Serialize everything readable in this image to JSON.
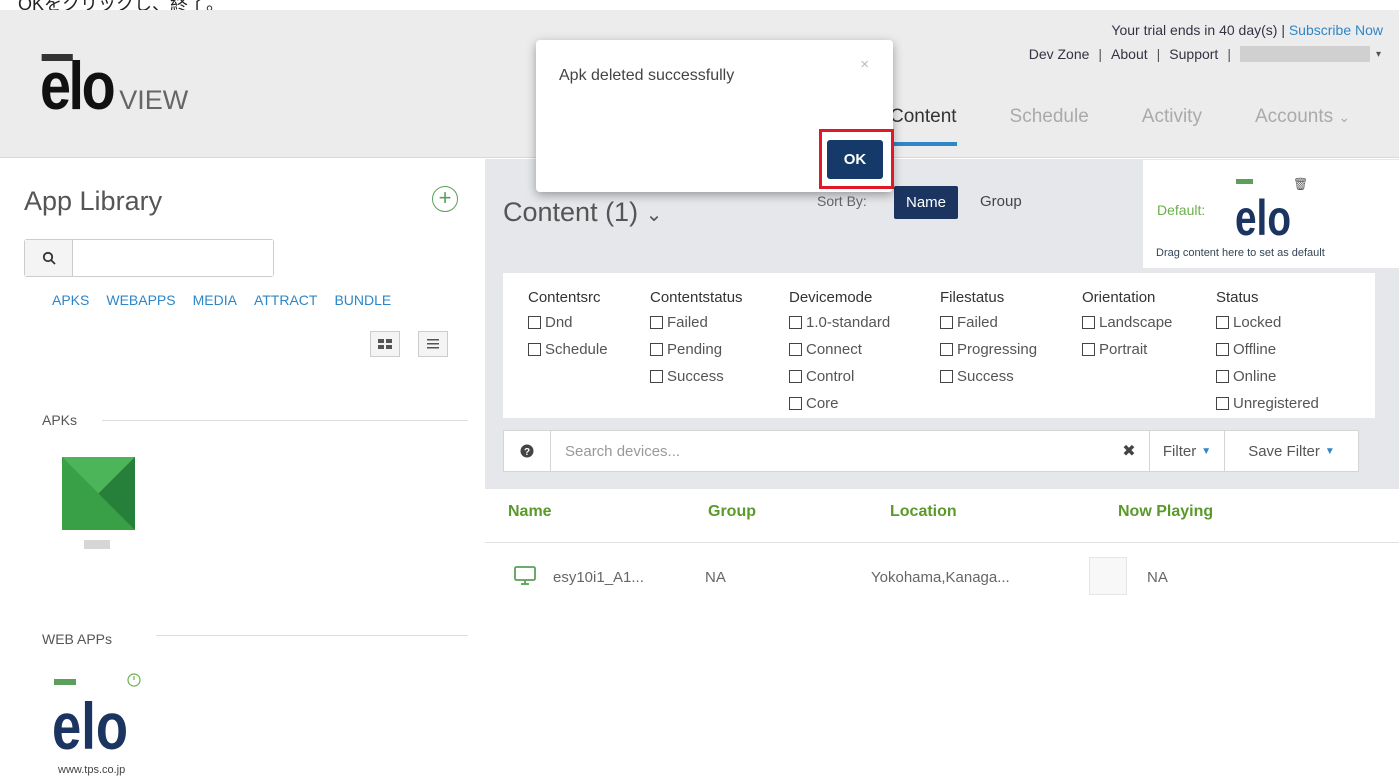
{
  "caption": "OKをクリックし、終了。",
  "header": {
    "trial_text": "Your trial ends in 40 day(s) | ",
    "subscribe_label": "Subscribe Now",
    "links": [
      "Dev Zone",
      "About",
      "Support"
    ],
    "logo_text": "elo",
    "logo_view": "VIEW",
    "tabs": [
      "Content",
      "Schedule",
      "Activity",
      "Accounts"
    ],
    "active_tab": "Content",
    "accent_color": "#2e86c8"
  },
  "sidebar": {
    "title": "App Library",
    "search_icon": "search-icon",
    "search_placeholder": "",
    "filters": [
      "APKS",
      "WEBAPPS",
      "MEDIA",
      "ATTRACT",
      "BUNDLE"
    ],
    "sections": [
      "APKs",
      "WEB APPs"
    ],
    "web_url": "www.tps.co.jp"
  },
  "content": {
    "title": "Content (1)",
    "sort_by_label": "Sort By:",
    "sort_name": "Name",
    "sort_group": "Group",
    "default_label": "Default:",
    "default_logo": "elo",
    "default_drag": "Drag content here to set as default",
    "filter_columns": [
      {
        "header": "Contentsrc",
        "options": [
          "Dnd",
          "Schedule"
        ]
      },
      {
        "header": "Contentstatus",
        "options": [
          "Failed",
          "Pending",
          "Success"
        ]
      },
      {
        "header": "Devicemode",
        "options": [
          "1.0-standard",
          "Connect",
          "Control",
          "Core"
        ]
      },
      {
        "header": "Filestatus",
        "options": [
          "Failed",
          "Progressing",
          "Success"
        ]
      },
      {
        "header": "Orientation",
        "options": [
          "Landscape",
          "Portrait"
        ]
      },
      {
        "header": "Status",
        "options": [
          "Locked",
          "Offline",
          "Online",
          "Unregistered"
        ]
      }
    ],
    "search_placeholder": "Search devices...",
    "filter_label": "Filter",
    "save_filter_label": "Save Filter"
  },
  "table": {
    "columns": [
      "Name",
      "Group",
      "Location",
      "Now Playing"
    ],
    "rows": [
      {
        "name": "esy10i1_A1...",
        "group": "NA",
        "location": "Yokohama,Kanaga...",
        "now_playing": "NA"
      }
    ]
  },
  "modal": {
    "message": "Apk deleted successfully",
    "close_symbol": "×",
    "ok_label": "OK",
    "highlight_color": "#e0192a"
  }
}
